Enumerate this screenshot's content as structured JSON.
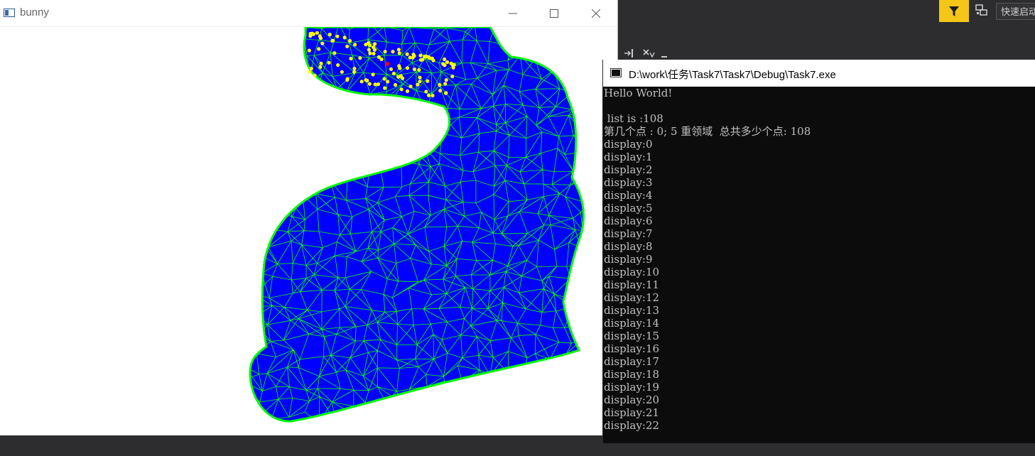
{
  "ide": {
    "quick_launch_placeholder": "快速启动",
    "accent_color": "#f5c518"
  },
  "bunny_window": {
    "title": "bunny",
    "mesh_fill_color": "#0000ff",
    "mesh_edge_color": "#00ff00",
    "selected_point_color": "#ffff00",
    "center_point_color": "#ff0000"
  },
  "console_window": {
    "title": "D:\\work\\任务\\Task7\\Task7\\Debug\\Task7.exe",
    "lines": [
      "Hello World!",
      "",
      " list is :108",
      "第几个点 : 0; 5 重领域  总共多少个点: 108",
      "display:0",
      "display:1",
      "display:2",
      "display:3",
      "display:4",
      "display:5",
      "display:6",
      "display:7",
      "display:8",
      "display:9",
      "display:10",
      "display:11",
      "display:12",
      "display:13",
      "display:14",
      "display:15",
      "display:16",
      "display:17",
      "display:18",
      "display:19",
      "display:20",
      "display:21",
      "display:22"
    ]
  }
}
